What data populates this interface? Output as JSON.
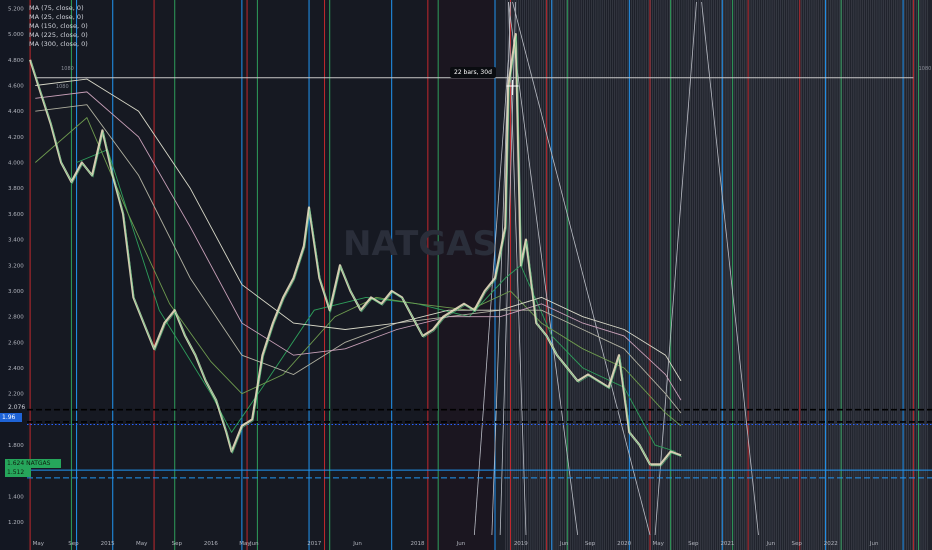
{
  "chart_data": {
    "type": "line",
    "symbol_watermark": "NATGAS",
    "legend": [
      "MA (75, close, 0)",
      "MA (25, close, 0)",
      "MA (150, close, 0)",
      "MA (225, close, 0)",
      "MA (300, close, 0)"
    ],
    "y_ticks": [
      5.2,
      5.0,
      4.8,
      4.6,
      4.4,
      4.2,
      4.0,
      3.8,
      3.6,
      3.4,
      3.2,
      3.0,
      2.8,
      2.6,
      2.4,
      2.2,
      1.8,
      1.6,
      1.4,
      1.2
    ],
    "y_tick_labels": [
      "5.200",
      "5.000",
      "4.800",
      "4.600",
      "4.400",
      "4.200",
      "4.000",
      "3.800",
      "3.600",
      "3.400",
      "3.200",
      "3.000",
      "2.800",
      "2.600",
      "2.400",
      "2.200",
      "1.800",
      "1.600",
      "1.400",
      "1.200"
    ],
    "ylim": [
      1.1,
      5.25
    ],
    "x_ticks": [
      {
        "label": "May",
        "t": 2014.33
      },
      {
        "label": "Sep",
        "t": 2014.67
      },
      {
        "label": "2015",
        "t": 2015.0
      },
      {
        "label": "May",
        "t": 2015.33
      },
      {
        "label": "Sep",
        "t": 2015.67
      },
      {
        "label": "2016",
        "t": 2016.0
      },
      {
        "label": "May",
        "t": 2016.33
      },
      {
        "label": "Jun",
        "t": 2016.42
      },
      {
        "label": "2017",
        "t": 2017.0
      },
      {
        "label": "Jun",
        "t": 2017.42
      },
      {
        "label": "2018",
        "t": 2018.0
      },
      {
        "label": "Jun",
        "t": 2018.42
      },
      {
        "label": "2019",
        "t": 2019.0
      },
      {
        "label": "Jun",
        "t": 2019.42
      },
      {
        "label": "Sep",
        "t": 2019.67
      },
      {
        "label": "2020",
        "t": 2020.0
      },
      {
        "label": "May",
        "t": 2020.33
      },
      {
        "label": "Sep",
        "t": 2020.67
      },
      {
        "label": "2021",
        "t": 2021.0
      },
      {
        "label": "Jun",
        "t": 2021.42
      },
      {
        "label": "Sep",
        "t": 2021.67
      },
      {
        "label": "2022",
        "t": 2022.0
      },
      {
        "label": "Jun",
        "t": 2022.42
      }
    ],
    "price_series": {
      "t": [
        2014.25,
        2014.35,
        2014.45,
        2014.55,
        2014.65,
        2014.75,
        2014.85,
        2014.95,
        2015.05,
        2015.15,
        2015.25,
        2015.35,
        2015.45,
        2015.55,
        2015.65,
        2015.75,
        2015.85,
        2015.95,
        2016.05,
        2016.15,
        2016.2,
        2016.3,
        2016.4,
        2016.5,
        2016.6,
        2016.7,
        2016.8,
        2016.9,
        2016.95,
        2017.05,
        2017.15,
        2017.25,
        2017.35,
        2017.45,
        2017.55,
        2017.65,
        2017.75,
        2017.85,
        2017.95,
        2018.05,
        2018.15,
        2018.25,
        2018.35,
        2018.45,
        2018.55,
        2018.65,
        2018.75,
        2018.85,
        2018.88,
        2018.95,
        2019.0,
        2019.05,
        2019.15,
        2019.25,
        2019.35,
        2019.45,
        2019.55,
        2019.65,
        2019.75,
        2019.85,
        2019.95,
        2020.05,
        2020.15,
        2020.25,
        2020.35,
        2020.45,
        2020.55
      ],
      "close": [
        4.8,
        4.55,
        4.3,
        4.0,
        3.85,
        4.0,
        3.9,
        4.25,
        3.9,
        3.6,
        2.95,
        2.75,
        2.55,
        2.75,
        2.85,
        2.65,
        2.5,
        2.3,
        2.15,
        1.9,
        1.75,
        1.95,
        2.0,
        2.5,
        2.75,
        2.95,
        3.1,
        3.35,
        3.65,
        3.1,
        2.85,
        3.2,
        3.0,
        2.85,
        2.95,
        2.9,
        3.0,
        2.95,
        2.8,
        2.65,
        2.7,
        2.8,
        2.85,
        2.9,
        2.85,
        3.0,
        3.1,
        3.5,
        4.6,
        5.0,
        3.2,
        3.4,
        2.75,
        2.65,
        2.5,
        2.4,
        2.3,
        2.35,
        2.3,
        2.25,
        2.5,
        1.9,
        1.8,
        1.65,
        1.65,
        1.75,
        1.72
      ]
    },
    "moving_averages": [
      {
        "period": 25,
        "color": "#2e9e5b",
        "t": [
          2014.7,
          2015.0,
          2015.5,
          2016.0,
          2016.2,
          2016.5,
          2017.0,
          2017.5,
          2018.0,
          2018.5,
          2018.85,
          2019.0,
          2019.3,
          2019.6,
          2020.0,
          2020.3,
          2020.5
        ],
        "y": [
          4.0,
          4.1,
          2.85,
          2.2,
          1.9,
          2.25,
          2.85,
          2.95,
          2.9,
          2.8,
          3.1,
          3.2,
          2.65,
          2.4,
          2.25,
          1.8,
          1.75
        ]
      },
      {
        "period": 75,
        "color": "#6e9b4f",
        "t": [
          2014.3,
          2014.8,
          2015.2,
          2015.6,
          2016.0,
          2016.3,
          2016.7,
          2017.2,
          2017.6,
          2018.0,
          2018.5,
          2018.9,
          2019.2,
          2019.6,
          2020.0,
          2020.4,
          2020.55
        ],
        "y": [
          4.0,
          4.35,
          3.6,
          2.9,
          2.45,
          2.2,
          2.35,
          2.8,
          2.95,
          2.9,
          2.85,
          3.0,
          2.75,
          2.55,
          2.4,
          2.05,
          1.95
        ]
      },
      {
        "period": 150,
        "color": "#b0b0a0",
        "t": [
          2014.3,
          2014.8,
          2015.3,
          2015.8,
          2016.3,
          2016.8,
          2017.3,
          2017.8,
          2018.3,
          2018.8,
          2019.2,
          2019.6,
          2020.0,
          2020.4,
          2020.55
        ],
        "y": [
          4.4,
          4.45,
          3.9,
          3.1,
          2.5,
          2.35,
          2.6,
          2.75,
          2.8,
          2.85,
          2.85,
          2.7,
          2.55,
          2.2,
          2.05
        ]
      },
      {
        "period": 225,
        "color": "#c8a0b8",
        "t": [
          2014.3,
          2014.8,
          2015.3,
          2015.8,
          2016.3,
          2016.8,
          2017.3,
          2017.8,
          2018.3,
          2018.8,
          2019.2,
          2019.6,
          2020.0,
          2020.4,
          2020.55
        ],
        "y": [
          4.5,
          4.55,
          4.2,
          3.5,
          2.75,
          2.5,
          2.55,
          2.7,
          2.8,
          2.8,
          2.9,
          2.75,
          2.65,
          2.35,
          2.15
        ]
      },
      {
        "period": 300,
        "color": "#d8d8c8",
        "t": [
          2014.3,
          2014.8,
          2015.3,
          2015.8,
          2016.3,
          2016.8,
          2017.3,
          2017.8,
          2018.3,
          2018.8,
          2019.2,
          2019.6,
          2020.0,
          2020.4,
          2020.55
        ],
        "y": [
          4.6,
          4.65,
          4.4,
          3.8,
          3.05,
          2.75,
          2.7,
          2.75,
          2.85,
          2.85,
          2.95,
          2.8,
          2.7,
          2.5,
          2.3
        ]
      }
    ],
    "horizontal_levels": [
      {
        "y": 4.66,
        "label": "1080",
        "color": "#c8c8c8",
        "style": "solid"
      },
      {
        "y": 2.076,
        "label": "2.076",
        "color": "#000000",
        "style": "dashed"
      },
      {
        "y": 1.98,
        "label": "1.98",
        "color": "#000000",
        "style": "dashed"
      },
      {
        "y": 1.96,
        "label": "",
        "color": "#2962ff",
        "style": "dotted"
      },
      {
        "y": 1.605,
        "label": "",
        "color": "#2196f3",
        "style": "solid"
      },
      {
        "y": 1.545,
        "label": "",
        "color": "#2196f3",
        "style": "dashed"
      }
    ],
    "annotations": {
      "bars_label": "22 bars, 30d",
      "level_label_left": "1080",
      "level_label_right": "1080",
      "level_label_mid": "1080"
    },
    "y_axis_tags": {
      "dark_label": "2.076",
      "blue_label": "1.96",
      "green_label1": "1.624 NATGAS",
      "green_label2": "1.512"
    },
    "cycle_lines": {
      "red": [
        2014.25,
        2015.45,
        2016.35,
        2017.1,
        2018.1,
        2018.9,
        2019.25,
        2020.25,
        2021.2,
        2021.7,
        2022.8
      ],
      "green": [
        2014.65,
        2015.65,
        2016.45,
        2017.15,
        2018.2,
        2019.45,
        2020.45,
        2021.05,
        2022.1,
        2022.85
      ],
      "blue": [
        2014.7,
        2015.05,
        2016.3,
        2016.95,
        2017.75,
        2018.75,
        2019.3,
        2020.05,
        2020.95,
        2021.95,
        2022.7
      ],
      "grid_start": 2018.85,
      "grid_end": 2022.95
    },
    "colors": {
      "background": "#131722",
      "shaded_background": "#1a1d24",
      "grid_panel": "#2a2d36",
      "price": "#e8e0c0"
    }
  }
}
